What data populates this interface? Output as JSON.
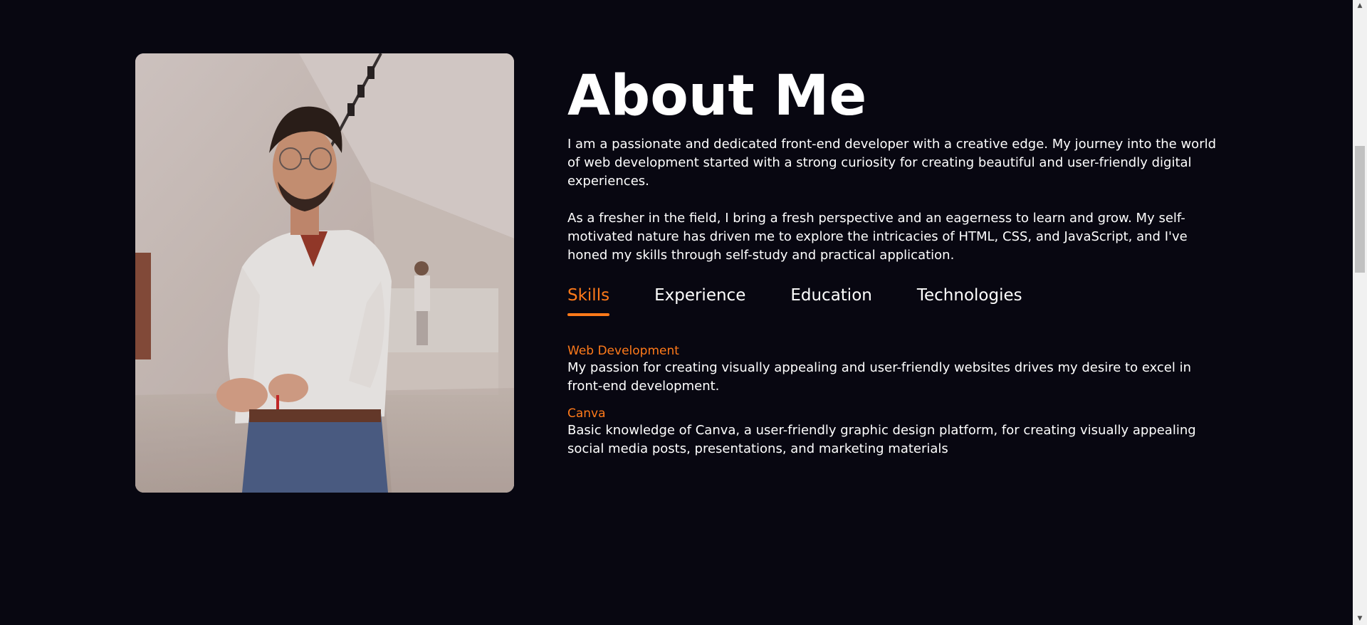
{
  "about": {
    "title": "About Me",
    "paragraph_1": "I am a passionate and dedicated front-end developer with a creative edge. My journey into the world of web development started with a strong curiosity for creating beautiful and user-friendly digital experiences.",
    "paragraph_2": "As a fresher in the field, I bring a fresh perspective and an eagerness to learn and grow. My self-motivated nature has driven me to explore the intricacies of HTML, CSS, and JavaScript, and I've honed my skills through self-study and practical application."
  },
  "tabs": [
    {
      "label": "Skills",
      "active": true
    },
    {
      "label": "Experience",
      "active": false
    },
    {
      "label": "Education",
      "active": false
    },
    {
      "label": "Technologies",
      "active": false
    }
  ],
  "skills": [
    {
      "name": "Web Development",
      "description": "My passion for creating visually appealing and user-friendly websites drives my desire to excel in front-end development."
    },
    {
      "name": "Canva",
      "description": "Basic knowledge of Canva, a user-friendly graphic design platform, for creating visually appealing social media posts, presentations, and marketing materials"
    }
  ],
  "colors": {
    "background": "#080711",
    "accent": "#ff7a1a",
    "text": "#ffffff"
  },
  "scrollbar": {
    "up_icon": "triangle-up-icon",
    "down_icon": "triangle-down-icon"
  }
}
